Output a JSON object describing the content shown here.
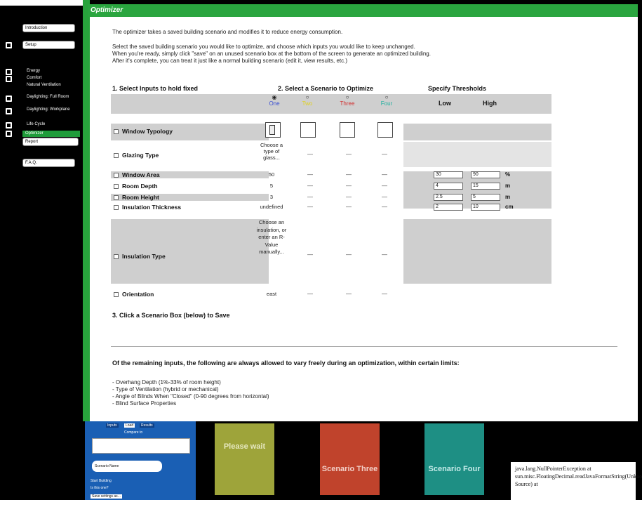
{
  "header": {
    "title": "Optimizer"
  },
  "sidebar": {
    "items": [
      {
        "label": "Introduction",
        "kind": "button",
        "icon": false
      },
      {
        "label": "Setup",
        "kind": "button",
        "icon": true
      },
      {
        "label": "Energy",
        "kind": "text",
        "icon": true
      },
      {
        "label": "Comfort",
        "kind": "text",
        "icon": true
      },
      {
        "label": "Natural Ventilation",
        "kind": "text",
        "icon": false
      },
      {
        "label": "Daylighting: Full Room",
        "kind": "text",
        "icon": true
      },
      {
        "label": "Daylighting: Workplane",
        "kind": "text",
        "icon": true
      },
      {
        "label": "Life Cycle",
        "kind": "text",
        "icon": true
      },
      {
        "label": "Optimizer",
        "kind": "active",
        "icon": true
      },
      {
        "label": "Report",
        "kind": "button",
        "icon": false
      },
      {
        "label": "F.A.Q.",
        "kind": "button",
        "icon": false
      }
    ]
  },
  "intro": {
    "line1": "The optimizer takes a saved building scenario and modifies it to reduce energy consumption.",
    "line2": "Select the saved building scenario you would like to optimize, and choose which inputs you would like to keep unchanged.",
    "line3": "When you're ready, simply click \"save\" on an unused scenario box at the bottom of the screen to generate an optimized building.",
    "line4": "After it's complete, you can treat it just like a normal building scenario (edit it, view results, etc.)"
  },
  "steps": {
    "step1": "1. Select Inputs to hold fixed",
    "step2": "2. Select a Scenario to Optimize",
    "thresholds": "Specify Thresholds",
    "step3": "3. Click a Scenario Box (below) to Save"
  },
  "scenarios": {
    "one": "One",
    "two": "Two",
    "three": "Three",
    "four": "Four",
    "colors": {
      "one": "#3a4fd0",
      "two": "#e0d020",
      "three": "#d03030",
      "four": "#20b0a0"
    }
  },
  "threshold_headers": {
    "low": "Low",
    "high": "High"
  },
  "rows": [
    {
      "label": "Window Typology",
      "value": "",
      "dash": false
    },
    {
      "label": "Glazing Type",
      "value": "Choose a type of glass...",
      "dash": true
    },
    {
      "label": "Window Area",
      "value": "50",
      "dash": true,
      "low": "30",
      "high": "90",
      "unit": "%"
    },
    {
      "label": "Room Depth",
      "value": "5",
      "dash": true,
      "low": "4",
      "high": "15",
      "unit": "m"
    },
    {
      "label": "Room Height",
      "value": "3",
      "dash": true,
      "low": "2.5",
      "high": "5",
      "unit": "m"
    },
    {
      "label": "Insulation Thickness",
      "value": "undefined",
      "dash": true,
      "low": "2",
      "high": "10",
      "unit": "cm"
    },
    {
      "label": "Insulation Type",
      "value": "Choose an insulation, or enter an R-Value manually...",
      "dash": true
    },
    {
      "label": "Orientation",
      "value": "east",
      "dash": true
    }
  ],
  "dash_text": "—",
  "remaining": {
    "heading": "Of the remaining inputs, the following are always allowed to vary freely during an optimization, within certain limits:",
    "items": [
      "- Overhang Depth (1%-33% of room height)",
      "- Type of Ventilation (hybrid or mechanical)",
      "- Angle of Blinds When \"Closed\" (0-90 degrees from horizontal)",
      "- Blind Surface Properties"
    ]
  },
  "bottom": {
    "mini_panel": {
      "tabs": [
        "Inputs",
        "Load",
        "Results"
      ],
      "select_label": "Compare to",
      "name_label": "Scenario Name",
      "lines": [
        "Start Building",
        "Is this one?",
        "Save settings as..."
      ]
    },
    "cards": [
      {
        "title": "Please wait",
        "color": "#9ea43a"
      },
      {
        "title": "Scenario Three",
        "color": "#c0432c"
      },
      {
        "title": "Scenario Four",
        "color": "#1e8f84"
      }
    ],
    "error": "java.lang.NullPointerException at sun.misc.FloatingDecimal.readJavaFormatString(Unknown Source) at"
  }
}
